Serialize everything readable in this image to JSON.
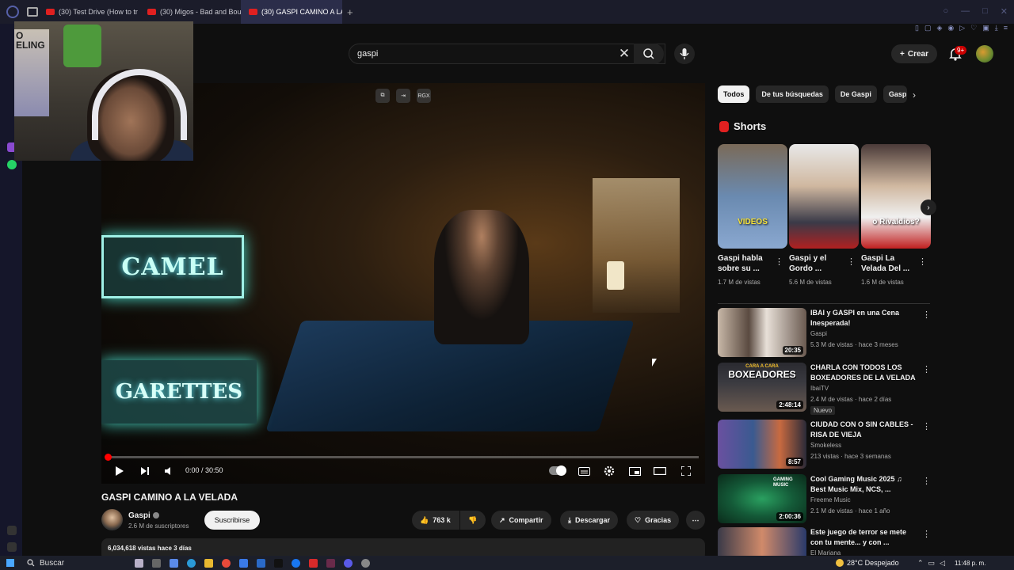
{
  "browser": {
    "tabs": [
      {
        "label": "(30) Test Drive (How to tr"
      },
      {
        "label": "(30) Migos - Bad and Bou"
      },
      {
        "label": "(30) GASPI CAMINO A LA"
      }
    ],
    "new_tab": "+"
  },
  "search": {
    "value": "gaspi"
  },
  "header": {
    "create_label": "Crear",
    "notif_count": "9+"
  },
  "webcam": {
    "poster_text": "O ELING"
  },
  "video": {
    "signs": [
      "CAMEL",
      "GARETTES"
    ],
    "overlay_label": "RGX",
    "time": "0:00 / 30:50",
    "progress": 0.005,
    "title": "GASPI CAMINO A LA VELADA"
  },
  "channel": {
    "name": "Gaspi",
    "subs": "2.6 M de suscriptores",
    "subscribe": "Suscribirse"
  },
  "actions": {
    "likes": "763 k",
    "share": "Compartir",
    "download": "Descargar",
    "thanks": "Gracias"
  },
  "description": {
    "summary": "6,034,618 vistas  hace 3 días"
  },
  "chips": [
    "Todos",
    "De tus búsquedas",
    "De Gaspi",
    "Gasp"
  ],
  "shorts": {
    "heading": "Shorts",
    "items": [
      {
        "caption": "VIDEOS",
        "title": "Gaspi habla sobre su ...",
        "views": "1.7 M de vistas"
      },
      {
        "caption": "",
        "title": "Gaspi y el Gordo ...",
        "views": "5.6 M de vistas"
      },
      {
        "caption": "o Rivaldios?",
        "title": "Gaspi La Velada Del ...",
        "views": "1.6 M de vistas"
      }
    ]
  },
  "recommendations": [
    {
      "title": "IBAI y GASPI en una Cena Inesperada!",
      "channel": "Gaspi",
      "meta": "5.3 M de vistas · hace 3 meses",
      "duration": "20:35",
      "badge": "",
      "thumb_text": ""
    },
    {
      "title": "CHARLA CON TODOS LOS BOXEADORES DE LA VELADA",
      "channel": "IbaiTV",
      "meta": "2.4 M de vistas · hace 2 días",
      "duration": "2:48:14",
      "badge": "Nuevo",
      "thumb_text": "BOXEADORES",
      "thumb_text_top": "CARA A CARA"
    },
    {
      "title": "CIUDAD CON O SIN CABLES - RISA DE VIEJA",
      "channel": "Smokeless",
      "meta": "213 vistas · hace 3 semanas",
      "duration": "8:57",
      "badge": "",
      "thumb_text": ""
    },
    {
      "title": "Cool Gaming Music 2025 ♫ Best Music Mix, NCS, ...",
      "channel": "Freeme Music",
      "meta": "2.1 M de vistas · hace 1 año",
      "duration": "2:00:36",
      "badge": "",
      "thumb_text": "GAMING MUSIC"
    },
    {
      "title": "Este juego de terror se mete con tu mente... y con ...",
      "channel": "El Mariana",
      "meta": "",
      "duration": "",
      "badge": "",
      "thumb_text": ""
    }
  ],
  "taskbar": {
    "search": "Buscar",
    "weather": "28°C  Despejado",
    "clock": "11:48 p. m."
  },
  "colors": {
    "brand_red": "#ff0000",
    "bg": "#0f0f0f",
    "neon": "#4ad9c8"
  }
}
